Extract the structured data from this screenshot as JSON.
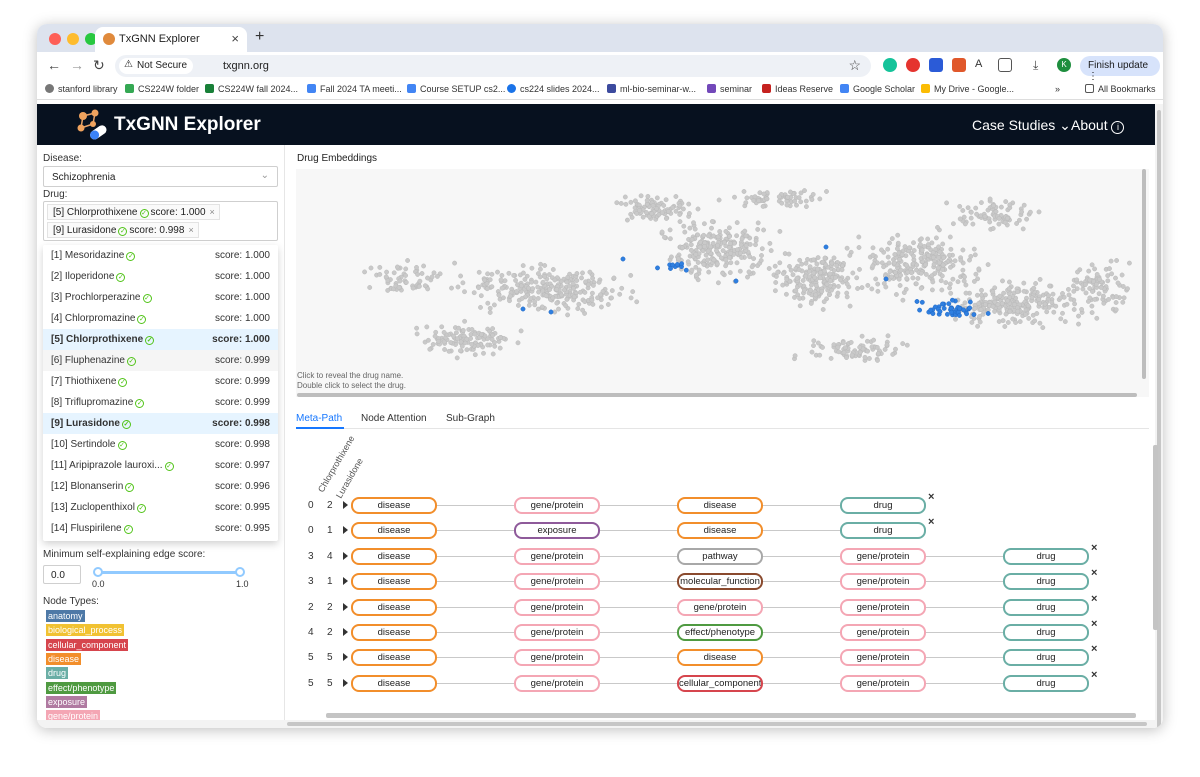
{
  "browser": {
    "tab_title": "TxGNN Explorer",
    "not_secure": "Not Secure",
    "url": "txgnn.org",
    "finish_update": "Finish update",
    "profile_initial": "K",
    "bookmarks": [
      "stanford library",
      "CS224W folder",
      "CS224W fall 2024...",
      "Fall 2024 TA meeti...",
      "Course SETUP cs2...",
      "cs224 slides 2024...",
      "ml-bio-seminar-w...",
      "seminar",
      "Ideas Reserve",
      "Google Scholar",
      "My Drive - Google...",
      "»",
      "All Bookmarks"
    ]
  },
  "header": {
    "title": "TxGNN Explorer",
    "case_studies": "Case Studies",
    "about": "About"
  },
  "sidebar": {
    "disease_label": "Disease:",
    "disease_value": "Schizophrenia",
    "drug_label": "Drug:",
    "selected_drugs": [
      {
        "name": "[5] Chlorprothixene",
        "score": "score: 1.000"
      },
      {
        "name": "[9] Lurasidone",
        "score": "score: 0.998"
      }
    ],
    "dropdown": [
      {
        "name": "[1] Mesoridazine",
        "score": "score: 1.000"
      },
      {
        "name": "[2] Iloperidone",
        "score": "score: 1.000"
      },
      {
        "name": "[3] Prochlorperazine",
        "score": "score: 1.000"
      },
      {
        "name": "[4] Chlorpromazine",
        "score": "score: 1.000"
      },
      {
        "name": "[5] Chlorprothixene",
        "score": "score: 1.000"
      },
      {
        "name": "[6] Fluphenazine",
        "score": "score: 0.999"
      },
      {
        "name": "[7] Thiothixene",
        "score": "score: 0.999"
      },
      {
        "name": "[8] Triflupromazine",
        "score": "score: 0.999"
      },
      {
        "name": "[9] Lurasidone",
        "score": "score: 0.998"
      },
      {
        "name": "[10] Sertindole",
        "score": "score: 0.998"
      },
      {
        "name": "[11] Aripiprazole lauroxi...",
        "score": "score: 0.997"
      },
      {
        "name": "[12] Blonanserin",
        "score": "score: 0.996"
      },
      {
        "name": "[13] Zuclopenthixol",
        "score": "score: 0.995"
      },
      {
        "name": "[14] Fluspirilene",
        "score": "score: 0.995"
      }
    ],
    "min_score_label": "Minimum self-explaining edge score:",
    "min_score_value": "0.0",
    "slider_min": "0.0",
    "slider_max": "1.0",
    "node_types_label": "Node Types:",
    "node_types": [
      {
        "name": "anatomy",
        "color": "#4e79a7"
      },
      {
        "name": "biological_process",
        "color": "#f1c232"
      },
      {
        "name": "cellular_component",
        "color": "#d6454d"
      },
      {
        "name": "disease",
        "color": "#f28e2b"
      },
      {
        "name": "drug",
        "color": "#6aaea5"
      },
      {
        "name": "effect/phenotype",
        "color": "#4f9a41"
      },
      {
        "name": "exposure",
        "color": "#b07aa1"
      },
      {
        "name": "gene/protein",
        "color": "#f4a6b4"
      }
    ]
  },
  "embeddings": {
    "title": "Drug Embeddings",
    "hint_line1": "Click to reveal the drug name.",
    "hint_line2": "Double click to select the drug."
  },
  "tabs": [
    "Meta-Path",
    "Node Attention",
    "Sub-Graph"
  ],
  "metapath": {
    "columns": [
      "Chlorprothixene",
      "Lurasidone"
    ],
    "rows": [
      {
        "counts": [
          "0",
          "2"
        ],
        "nodes": [
          "disease",
          "gene/protein",
          "disease",
          "drug"
        ]
      },
      {
        "counts": [
          "0",
          "1"
        ],
        "nodes": [
          "disease",
          "exposure",
          "disease",
          "drug"
        ]
      },
      {
        "counts": [
          "3",
          "4"
        ],
        "nodes": [
          "disease",
          "gene/protein",
          "pathway",
          "gene/protein",
          "drug"
        ]
      },
      {
        "counts": [
          "3",
          "1"
        ],
        "nodes": [
          "disease",
          "gene/protein",
          "molecular_function",
          "gene/protein",
          "drug"
        ]
      },
      {
        "counts": [
          "2",
          "2"
        ],
        "nodes": [
          "disease",
          "gene/protein",
          "gene/protein",
          "gene/protein",
          "drug"
        ]
      },
      {
        "counts": [
          "4",
          "2"
        ],
        "nodes": [
          "disease",
          "gene/protein",
          "effect/phenotype",
          "gene/protein",
          "drug"
        ]
      },
      {
        "counts": [
          "5",
          "5"
        ],
        "nodes": [
          "disease",
          "gene/protein",
          "disease",
          "gene/protein",
          "drug"
        ]
      },
      {
        "counts": [
          "5",
          "5"
        ],
        "nodes": [
          "disease",
          "gene/protein",
          "cellular_component",
          "gene/protein",
          "drug"
        ]
      }
    ],
    "node_colors": {
      "disease": "#f28e2b",
      "gene/protein": "#f4a6b4",
      "drug": "#6aaea5",
      "exposure": "#8e5a9a",
      "pathway": "#a8a8a8",
      "molecular_function": "#8a4a2e",
      "effect/phenotype": "#4f9a41",
      "cellular_component": "#d6454d"
    }
  }
}
